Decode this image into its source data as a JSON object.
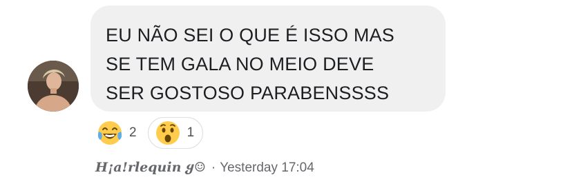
{
  "comment": {
    "lines": [
      "EU NÃO SEI O QUE É ISSO MAS",
      "SE TEM GALA NO MEIO DEVE",
      "SER GOSTOSO PARABENSSSS"
    ]
  },
  "reactions": [
    {
      "icon": "laughing-tears-emoji",
      "count": "2"
    },
    {
      "icon": "surprised-emoji",
      "count": "1"
    }
  ],
  "meta": {
    "author": "H¡a!rlequin ყ☺",
    "separator": "·",
    "time": "Yesterday 17:04"
  },
  "colors": {
    "bubble": "#f1f0f0",
    "text": "#1c1e21",
    "meta": "#65676b",
    "emoji_yellow": "#ffcc4d"
  }
}
